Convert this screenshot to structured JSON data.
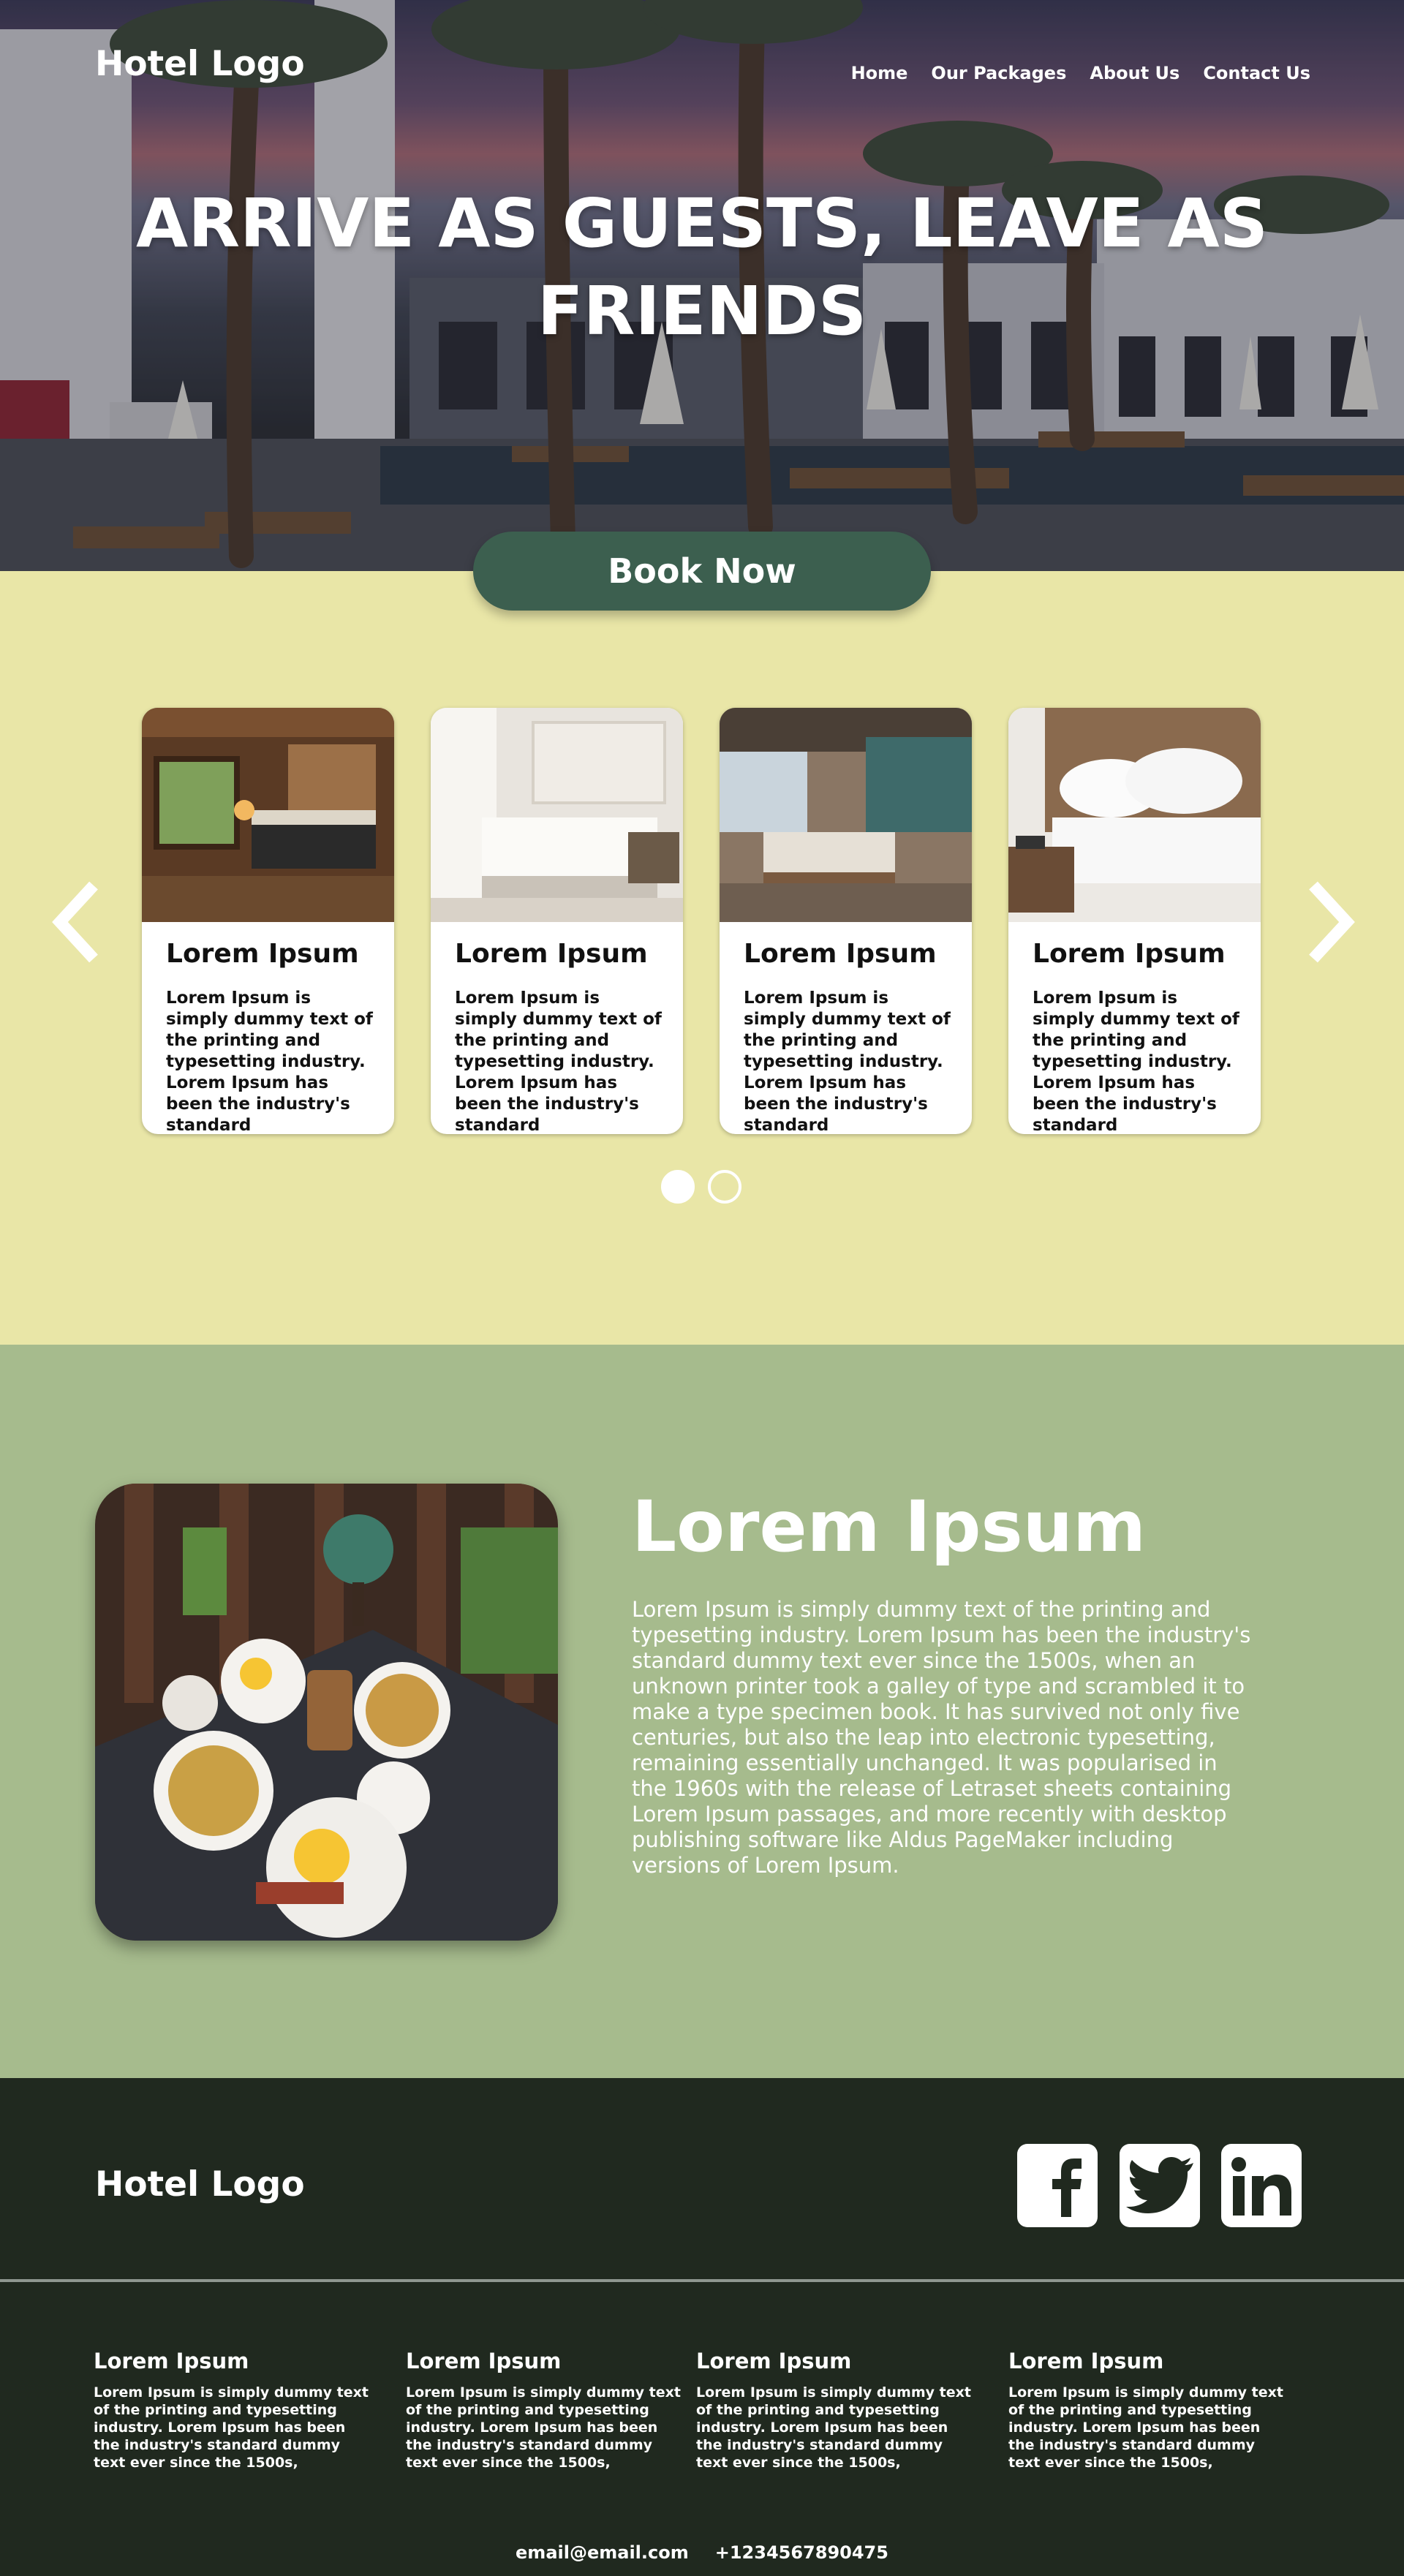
{
  "header": {
    "logo": "Hotel Logo",
    "nav": [
      "Home",
      "Our Packages",
      "About Us",
      "Contact Us"
    ]
  },
  "hero": {
    "title": "ARRIVE AS GUESTS, LEAVE AS FRIENDS",
    "cta": "Book Now"
  },
  "rooms": {
    "cards": [
      {
        "title": "Lorem Ipsum",
        "text": "Lorem Ipsum is simply dummy text of the printing and typesetting industry. Lorem Ipsum has been the industry's standard"
      },
      {
        "title": "Lorem Ipsum",
        "text": "Lorem Ipsum is simply dummy text of the printing and typesetting industry. Lorem Ipsum has been the industry's standard"
      },
      {
        "title": "Lorem Ipsum",
        "text": "Lorem Ipsum is simply dummy text of the printing and typesetting industry. Lorem Ipsum has been the industry's standard"
      },
      {
        "title": "Lorem Ipsum",
        "text": "Lorem Ipsum is simply dummy text of the printing and typesetting industry. Lorem Ipsum has been the industry's standard"
      }
    ],
    "prev_icon": "chevron-left-icon",
    "next_icon": "chevron-right-icon",
    "page_count": 2,
    "active_page": 1
  },
  "about": {
    "heading": "Lorem Ipsum",
    "body": "Lorem Ipsum is simply dummy text of the printing and typesetting industry. Lorem Ipsum has been the industry's standard dummy text ever since the 1500s, when an unknown printer took a galley of type and scrambled it to make a type specimen book. It has survived not only five centuries, but also the leap into electronic typesetting, remaining essentially unchanged. It was popularised in the 1960s with the release of Letraset sheets containing Lorem Ipsum passages, and more recently with desktop publishing software like Aldus PageMaker including versions of Lorem Ipsum."
  },
  "footer": {
    "logo": "Hotel Logo",
    "social": [
      "facebook-icon",
      "twitter-icon",
      "linkedin-icon"
    ],
    "columns": [
      {
        "title": "Lorem Ipsum",
        "text": "Lorem Ipsum is simply dummy text of the printing and typesetting industry. Lorem Ipsum has been the industry's standard dummy text ever since the 1500s,"
      },
      {
        "title": "Lorem Ipsum",
        "text": "Lorem Ipsum is simply dummy text of the printing and typesetting industry. Lorem Ipsum has been the industry's standard dummy text ever since the 1500s,"
      },
      {
        "title": "Lorem Ipsum",
        "text": "Lorem Ipsum is simply dummy text of the printing and typesetting industry. Lorem Ipsum has been the industry's standard dummy text ever since the 1500s,"
      },
      {
        "title": "Lorem Ipsum",
        "text": "Lorem Ipsum is simply dummy text of the printing and typesetting industry. Lorem Ipsum has been the industry's standard dummy text ever since the 1500s,"
      }
    ],
    "email": "email@email.com",
    "phone": "+1234567890475"
  },
  "colors": {
    "hero_band": "#e9e6a7",
    "about_band": "#a6bb8d",
    "footer_bg": "#20291f",
    "button": "#3c5f4f"
  }
}
